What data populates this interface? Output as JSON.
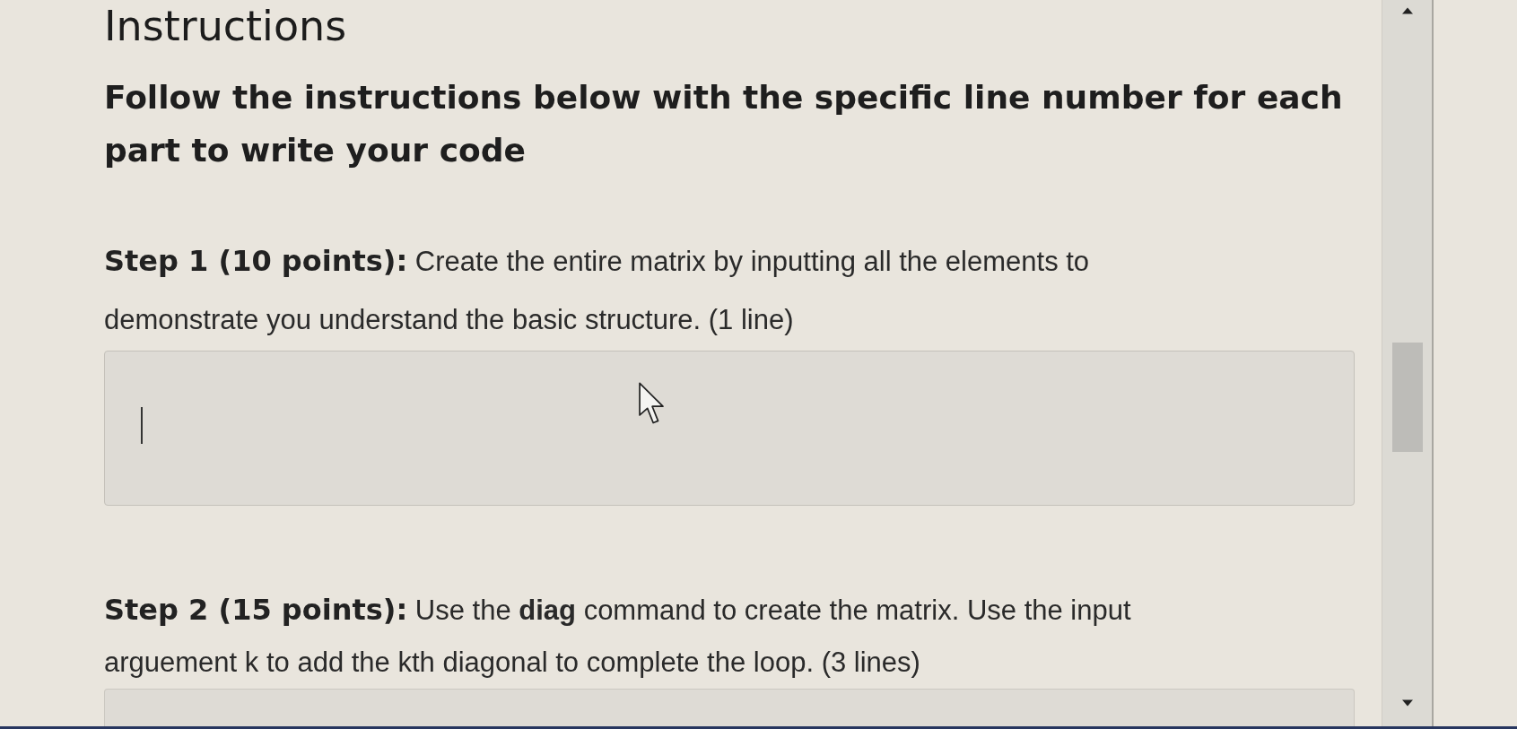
{
  "title": "Instructions",
  "intro": "Follow the instructions below with the specific line number for each part to write your code",
  "steps": [
    {
      "label": "Step 1 (10 points):",
      "text": "Create the entire matrix by inputting all the elements to demonstrate you understand the basic structure. (1 line)",
      "answer": {
        "focused": true
      }
    },
    {
      "label": "Step 2 (15 points):",
      "text": "Use the **diag** command to create the matrix. Use the input arguement k to add the kth diagonal to complete the loop. (3 lines)",
      "answer": {
        "focused": false
      }
    }
  ]
}
